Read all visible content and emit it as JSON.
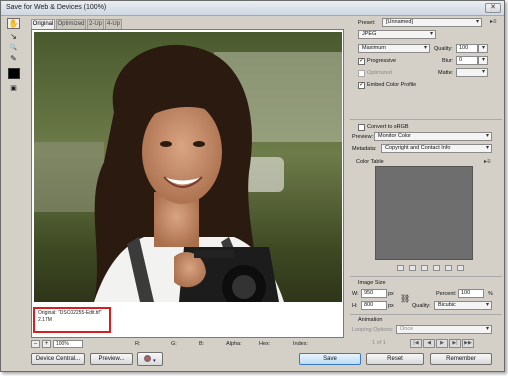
{
  "window": {
    "title": "Save for Web & Devices (100%)",
    "close_glyph": "✕"
  },
  "tools": [
    {
      "name": "hand-tool",
      "glyph": "✋"
    },
    {
      "name": "slice-select-tool",
      "glyph": "↘"
    },
    {
      "name": "zoom-tool",
      "glyph": "🔍"
    },
    {
      "name": "eyedropper-tool",
      "glyph": "✎"
    }
  ],
  "eyedropper_color": "#000000",
  "tabs": [
    "Original",
    "Optimized",
    "2-Up",
    "4-Up"
  ],
  "preview_info": {
    "filename": "Original: \"DSC02255-Edit.tif\"",
    "size": "2.17M"
  },
  "status": {
    "zoom_minus": "–",
    "zoom_plus": "+",
    "zoom": "100%",
    "r": "R:",
    "g": "G:",
    "b": "B:",
    "alpha": "Alpha:",
    "hex": "Hex:",
    "index": "Index:"
  },
  "buttons": {
    "device_central": "Device Central...",
    "preview": "Preview...",
    "save": "Save",
    "reset": "Reset",
    "remember": "Remember"
  },
  "settings": {
    "preset_label": "Preset:",
    "preset_value": "[Unnamed]",
    "format": "JPEG",
    "quality_preset": "Maximum",
    "quality_label": "Quality:",
    "quality_value": "100",
    "progressive": "Progressive",
    "blur_label": "Blur:",
    "blur_value": "0",
    "optimized": "Optimized",
    "matte_label": "Matte:",
    "embed_profile": "Embed Color Profile",
    "convert_srgb": "Convert to sRGB",
    "preview_label": "Preview:",
    "preview_value": "Monitor Color",
    "metadata_label": "Metadata:",
    "metadata_value": "Copyright and Contact Info",
    "color_table": "Color Table",
    "image_size": "Image Size",
    "w_label": "W:",
    "w_value": "950",
    "h_label": "H:",
    "h_value": "800",
    "px": "px",
    "percent_label": "Percent:",
    "percent_value": "100",
    "percent_unit": "%",
    "quality2_label": "Quality:",
    "quality2_value": "Bicubic",
    "animation": "Animation",
    "looping_label": "Looping Options:",
    "looping_value": "Once",
    "page": "1 of 1"
  }
}
